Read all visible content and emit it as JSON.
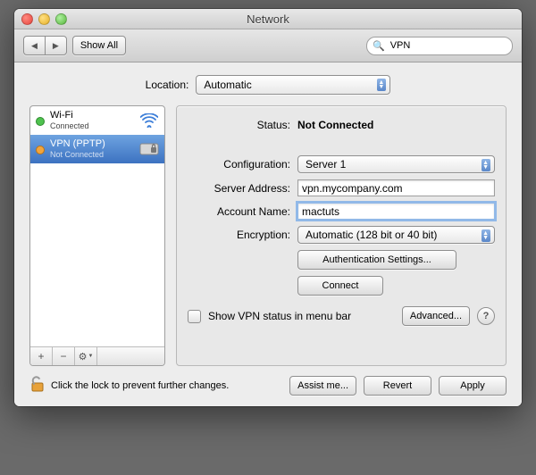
{
  "window": {
    "title": "Network"
  },
  "toolbar": {
    "show_all": "Show All",
    "search_value": "VPN"
  },
  "location": {
    "label": "Location:",
    "value": "Automatic"
  },
  "sidebar": {
    "items": [
      {
        "name": "Wi-Fi",
        "status": "Connected"
      },
      {
        "name": "VPN (PPTP)",
        "status": "Not Connected"
      }
    ]
  },
  "panel": {
    "status_label": "Status:",
    "status_value": "Not Connected",
    "config_label": "Configuration:",
    "config_value": "Server 1",
    "server_label": "Server Address:",
    "server_value": "vpn.mycompany.com",
    "account_label": "Account Name:",
    "account_value": "mactuts",
    "encryption_label": "Encryption:",
    "encryption_value": "Automatic (128 bit or 40 bit)",
    "auth_btn": "Authentication Settings...",
    "connect_btn": "Connect",
    "show_status_label": "Show VPN status in menu bar",
    "advanced_btn": "Advanced..."
  },
  "footer": {
    "lock_text": "Click the lock to prevent further changes.",
    "assist_btn": "Assist me...",
    "revert_btn": "Revert",
    "apply_btn": "Apply"
  }
}
